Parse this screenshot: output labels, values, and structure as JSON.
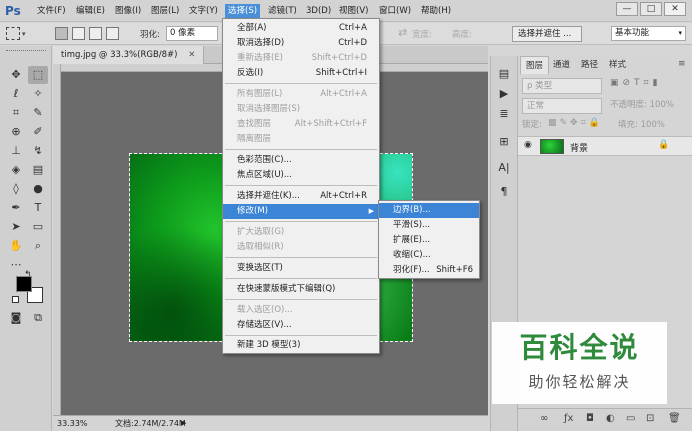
{
  "app": {
    "logo": "Ps"
  },
  "menubar": {
    "items": [
      "文件(F)",
      "编辑(E)",
      "图像(I)",
      "图层(L)",
      "文字(Y)",
      "选择(S)",
      "滤镜(T)",
      "3D(D)",
      "视图(V)",
      "窗口(W)",
      "帮助(H)"
    ],
    "active_index": 5,
    "window_controls": [
      "—",
      "□",
      "✕"
    ]
  },
  "options_bar": {
    "feather_label": "羽化:",
    "feather_value": "0 像素",
    "width_label": "宽度:",
    "height_label": "高度:",
    "select_and_mask_button": "选择并遮住 ...",
    "workspace_select": "基本功能"
  },
  "document": {
    "tab_title": "timg.jpg @ 33.3%(RGB/8#)",
    "tab_close": "✕",
    "zoom": "33.33%",
    "doc_info": "文档:2.74M/2.74M"
  },
  "select_menu": {
    "items": [
      {
        "label": "全部(A)",
        "shortcut": "Ctrl+A",
        "disabled": false
      },
      {
        "label": "取消选择(D)",
        "shortcut": "Ctrl+D",
        "disabled": false
      },
      {
        "label": "重新选择(E)",
        "shortcut": "Shift+Ctrl+D",
        "disabled": true
      },
      {
        "label": "反选(I)",
        "shortcut": "Shift+Ctrl+I",
        "disabled": false
      },
      {
        "label": "所有图层(L)",
        "shortcut": "Alt+Ctrl+A",
        "disabled": true
      },
      {
        "label": "取消选择图层(S)",
        "shortcut": "",
        "disabled": true
      },
      {
        "label": "查找图层",
        "shortcut": "Alt+Shift+Ctrl+F",
        "disabled": true
      },
      {
        "label": "隔离图层",
        "shortcut": "",
        "disabled": true
      },
      {
        "label": "色彩范围(C)...",
        "shortcut": "",
        "disabled": false
      },
      {
        "label": "焦点区域(U)...",
        "shortcut": "",
        "disabled": false
      },
      {
        "label": "选择并遮住(K)...",
        "shortcut": "Alt+Ctrl+R",
        "disabled": false
      },
      {
        "label": "修改(M)",
        "shortcut": "",
        "disabled": false
      },
      {
        "label": "扩大选取(G)",
        "shortcut": "",
        "disabled": true
      },
      {
        "label": "选取相似(R)",
        "shortcut": "",
        "disabled": true
      },
      {
        "label": "变换选区(T)",
        "shortcut": "",
        "disabled": false
      },
      {
        "label": "在快速蒙版模式下编辑(Q)",
        "shortcut": "",
        "disabled": false
      },
      {
        "label": "载入选区(O)...",
        "shortcut": "",
        "disabled": true
      },
      {
        "label": "存储选区(V)...",
        "shortcut": "",
        "disabled": false
      },
      {
        "label": "新建 3D 模型(3)",
        "shortcut": "",
        "disabled": false
      }
    ]
  },
  "modify_submenu": {
    "items": [
      {
        "label": "边界(B)...",
        "shortcut": ""
      },
      {
        "label": "平滑(S)...",
        "shortcut": ""
      },
      {
        "label": "扩展(E)...",
        "shortcut": ""
      },
      {
        "label": "收缩(C)...",
        "shortcut": ""
      },
      {
        "label": "羽化(F)...",
        "shortcut": "Shift+F6"
      }
    ]
  },
  "layers_panel": {
    "tabs": [
      "图层",
      "通道",
      "路径",
      "样式"
    ],
    "filter_label": "ρ 类型",
    "blend_mode": "正常",
    "opacity_label": "不透明度: 100%",
    "lock_label": "锁定:",
    "fill_label": "填充: 100%",
    "layer_name": "背景"
  },
  "watermark": {
    "title": "百科全说",
    "subtitle": "助你轻松解决"
  },
  "colors": {
    "accent": "#3b84d6",
    "menu_bg": "#f0f0f0",
    "workspace_bg": "#6b6b6b",
    "watermark_green": "#2f8a3c"
  }
}
